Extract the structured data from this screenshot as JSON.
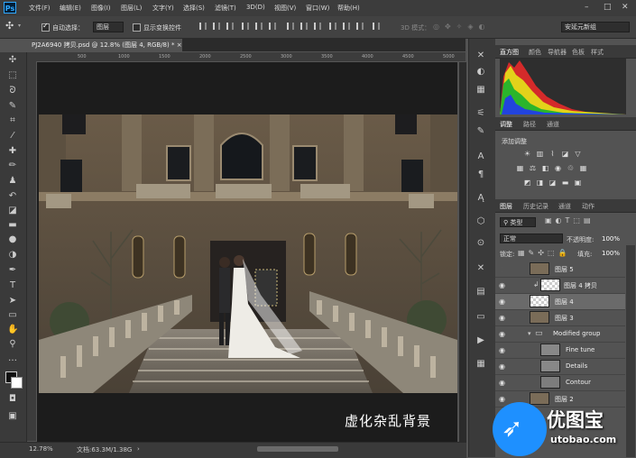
{
  "app": {
    "logo": "Ps"
  },
  "menu": [
    "文件(F)",
    "编辑(E)",
    "图像(I)",
    "图层(L)",
    "文字(Y)",
    "选择(S)",
    "滤镜(T)",
    "3D(D)",
    "视图(V)",
    "窗口(W)",
    "帮助(H)"
  ],
  "window_controls": {
    "minimize": "–",
    "restore": "□",
    "close": "✕"
  },
  "options": {
    "auto_select_label": "自动选择：",
    "auto_select_checked": true,
    "auto_select_value": "图层",
    "show_transform_label": "显示变换控件",
    "show_transform_checked": false,
    "mode_3d_label": "3D 模式：",
    "workspace_value": "安延元新组"
  },
  "document": {
    "tab_title": "PJ2A6940 拷贝.psd @ 12.8% (图层 4, RGB/8) *",
    "tab_close": "×",
    "caption": "虚化杂乱背景"
  },
  "ruler_labels": [
    "500",
    "1000",
    "1500",
    "2000",
    "2500",
    "3000",
    "3500",
    "4000",
    "4500",
    "5000"
  ],
  "status": {
    "zoom": "12.78%",
    "doc_info": "文档:63.3M/1.38G",
    "arrow": "›"
  },
  "panels": {
    "top_tabs": [
      "直方图",
      "颜色",
      "导航器",
      "色板",
      "样式"
    ],
    "adjust_tabs": [
      "调整",
      "路径",
      "通道"
    ],
    "adjust_title": "添加调整",
    "layer_tabs": [
      "图层",
      "历史记录",
      "通道",
      "动作"
    ],
    "filter_kind": "类型",
    "blend_mode": "正常",
    "opacity_label": "不透明度:",
    "opacity_value": "100%",
    "lock_label": "锁定:",
    "fill_label": "填充:",
    "fill_value": "100%"
  },
  "layers": [
    {
      "name": "图层 5",
      "visible": false,
      "indent": 0
    },
    {
      "name": "图层 4 拷贝",
      "visible": true,
      "indent": 1
    },
    {
      "name": "图层 4",
      "visible": true,
      "indent": 0,
      "selected": true
    },
    {
      "name": "图层 3",
      "visible": true,
      "indent": 0
    },
    {
      "name": "Modified group",
      "visible": true,
      "indent": 0,
      "group": true
    },
    {
      "name": "Fine tune",
      "visible": true,
      "indent": 2
    },
    {
      "name": "Details",
      "visible": true,
      "indent": 2
    },
    {
      "name": "Contour",
      "visible": true,
      "indent": 2
    },
    {
      "name": "图层 2",
      "visible": true,
      "indent": 0
    }
  ],
  "watermark": {
    "text": "优图宝",
    "url": "utobao.com"
  }
}
